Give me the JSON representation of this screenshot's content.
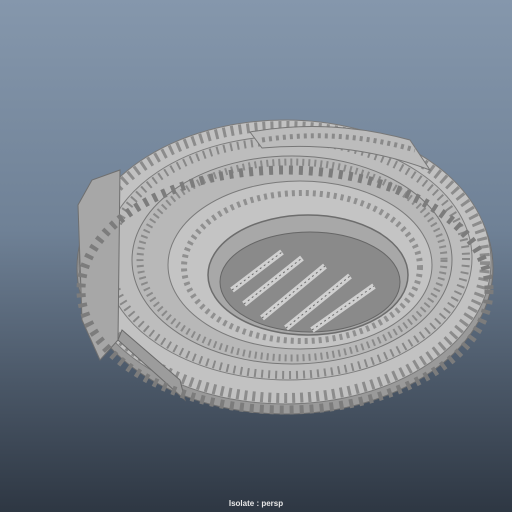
{
  "viewport": {
    "label": "Isolate : persp",
    "model": "colosseum-model",
    "background_top": "#8597ac",
    "background_bottom": "#2e3743",
    "model_color": "#b3b3b3"
  }
}
